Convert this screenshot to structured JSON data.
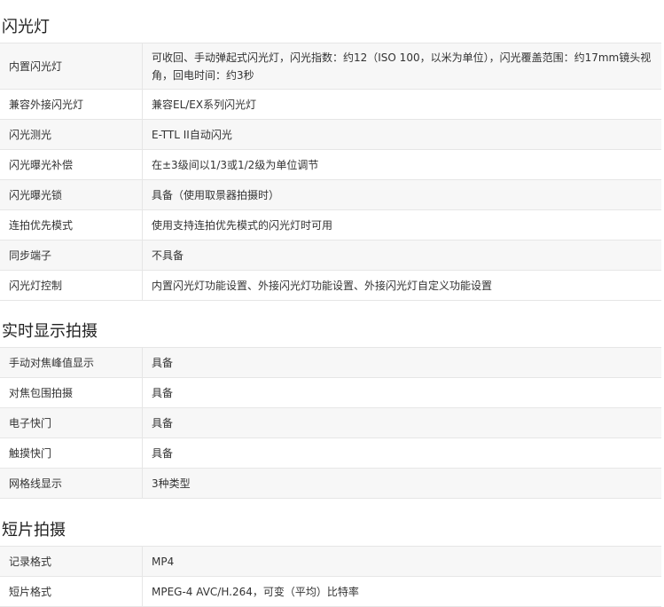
{
  "sections": [
    {
      "title": "闪光灯",
      "rows": [
        {
          "key": "内置闪光灯",
          "value": "可收回、手动弹起式闪光灯，闪光指数：约12（ISO 100，以米为单位），闪光覆盖范围：约17mm镜头视角，回电时间：约3秒"
        },
        {
          "key": "兼容外接闪光灯",
          "value": "兼容EL/EX系列闪光灯"
        },
        {
          "key": "闪光测光",
          "value": "E-TTL II自动闪光"
        },
        {
          "key": "闪光曝光补偿",
          "value": "在±3级间以1/3或1/2级为单位调节"
        },
        {
          "key": "闪光曝光锁",
          "value": "具备（使用取景器拍摄时）"
        },
        {
          "key": "连拍优先模式",
          "value": "使用支持连拍优先模式的闪光灯时可用"
        },
        {
          "key": "同步端子",
          "value": "不具备"
        },
        {
          "key": "闪光灯控制",
          "value": "内置闪光灯功能设置、外接闪光灯功能设置、外接闪光灯自定义功能设置"
        }
      ]
    },
    {
      "title": "实时显示拍摄",
      "rows": [
        {
          "key": "手动对焦峰值显示",
          "value": "具备"
        },
        {
          "key": "对焦包围拍摄",
          "value": "具备"
        },
        {
          "key": "电子快门",
          "value": "具备"
        },
        {
          "key": "触摸快门",
          "value": "具备"
        },
        {
          "key": "网格线显示",
          "value": "3种类型"
        }
      ]
    },
    {
      "title": "短片拍摄",
      "rows": [
        {
          "key": "记录格式",
          "value": "MP4"
        },
        {
          "key": "短片格式",
          "value": "MPEG-4 AVC/H.264，可变（平均）比特率"
        }
      ]
    }
  ]
}
